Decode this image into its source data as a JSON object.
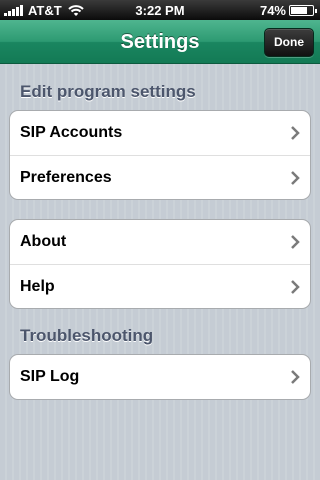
{
  "status": {
    "carrier": "AT&T",
    "time": "3:22 PM",
    "battery": "74%",
    "battery_level": 0.74
  },
  "nav": {
    "title": "Settings",
    "done_label": "Done"
  },
  "sections": [
    {
      "header": "Edit program settings",
      "rows": [
        {
          "label": "SIP Accounts"
        },
        {
          "label": "Preferences"
        }
      ]
    },
    {
      "header": "",
      "rows": [
        {
          "label": "About"
        },
        {
          "label": "Help"
        }
      ]
    },
    {
      "header": "Troubleshooting",
      "rows": [
        {
          "label": "SIP Log"
        }
      ]
    }
  ],
  "colors": {
    "nav_accent": "#2d9a72",
    "header_text": "#4c566c",
    "background": "#c5ccd4"
  }
}
